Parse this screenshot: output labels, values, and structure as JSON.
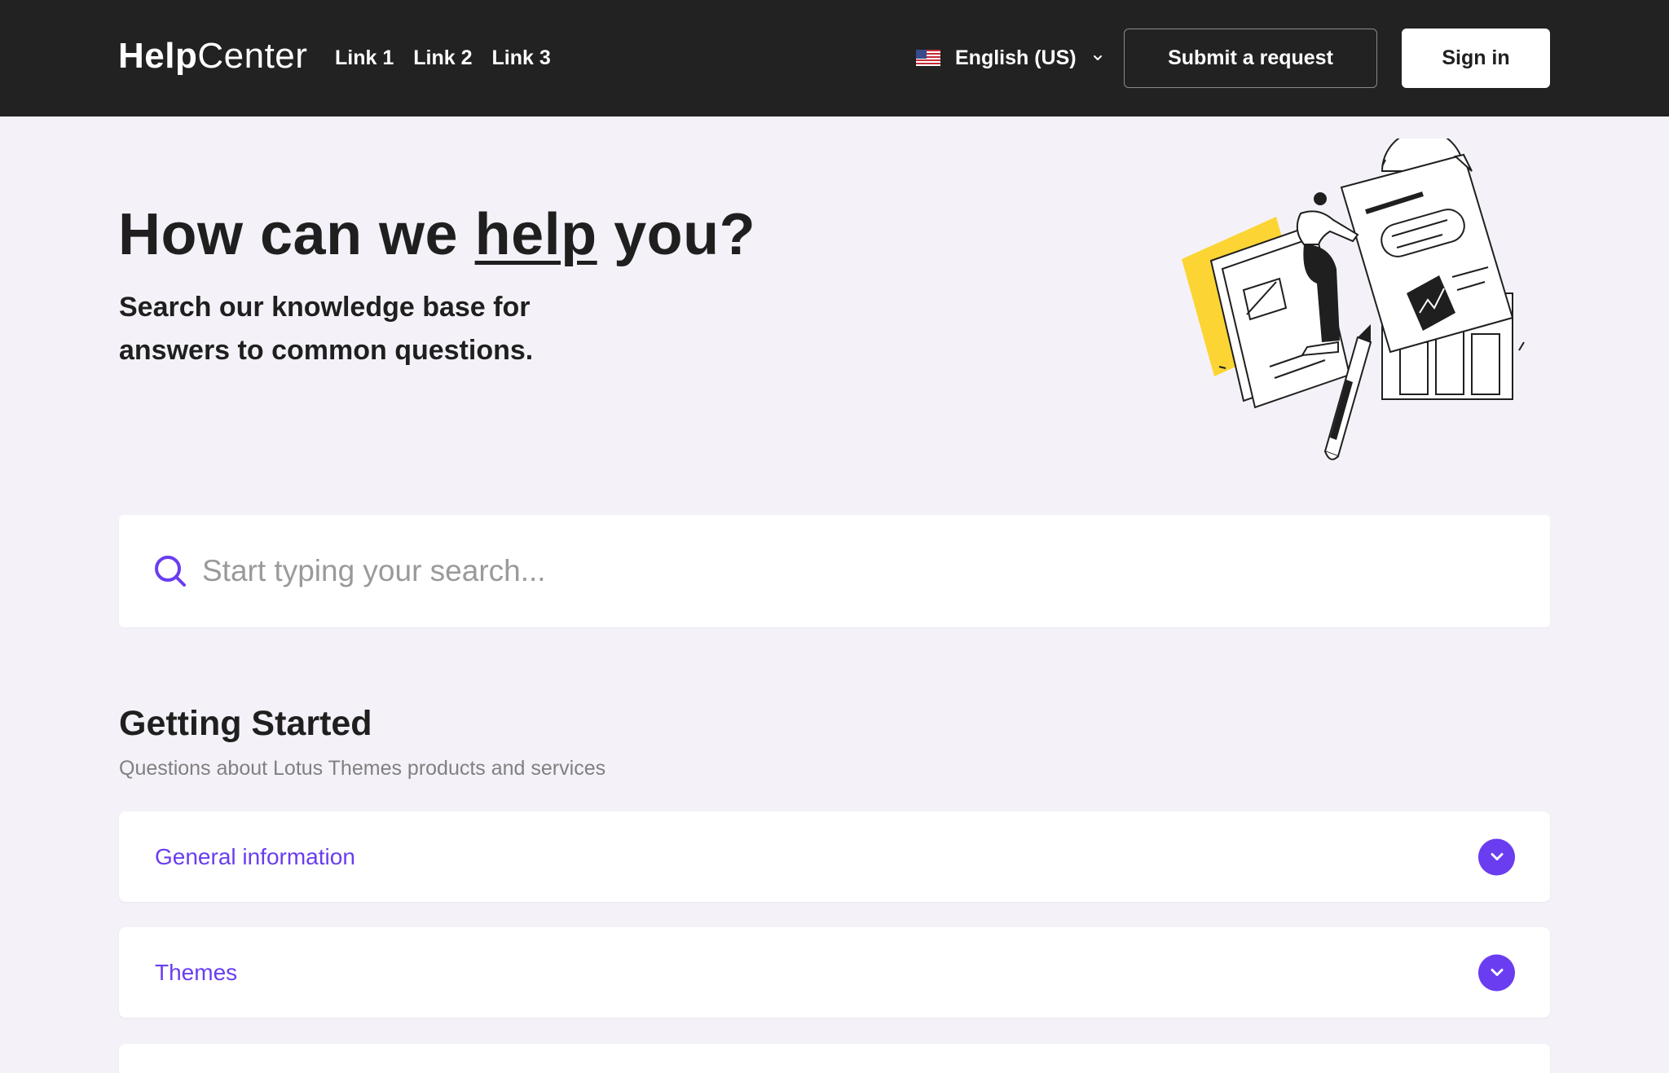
{
  "header": {
    "logo": {
      "bold": "Help",
      "light": "Center"
    },
    "nav_links": [
      "Link 1",
      "Link 2",
      "Link 3"
    ],
    "language": {
      "label": "English (US)",
      "flag_icon": "us-flag-icon"
    },
    "submit_request_label": "Submit a request",
    "sign_in_label": "Sign in"
  },
  "hero": {
    "title_before": "How can we ",
    "title_underlined": "help",
    "title_after": " you?",
    "subtitle": "Search our knowledge base for answers to common questions."
  },
  "search": {
    "placeholder": "Start typing your search...",
    "value": ""
  },
  "section": {
    "title": "Getting Started",
    "description": "Questions about Lotus Themes products and services",
    "items": [
      {
        "label": "General information"
      },
      {
        "label": "Themes"
      },
      {
        "label": ""
      }
    ]
  },
  "colors": {
    "header_bg": "#222222",
    "page_bg": "#f4f2f8",
    "accent": "#6a3df0",
    "illustration_highlight": "#fcd535"
  }
}
